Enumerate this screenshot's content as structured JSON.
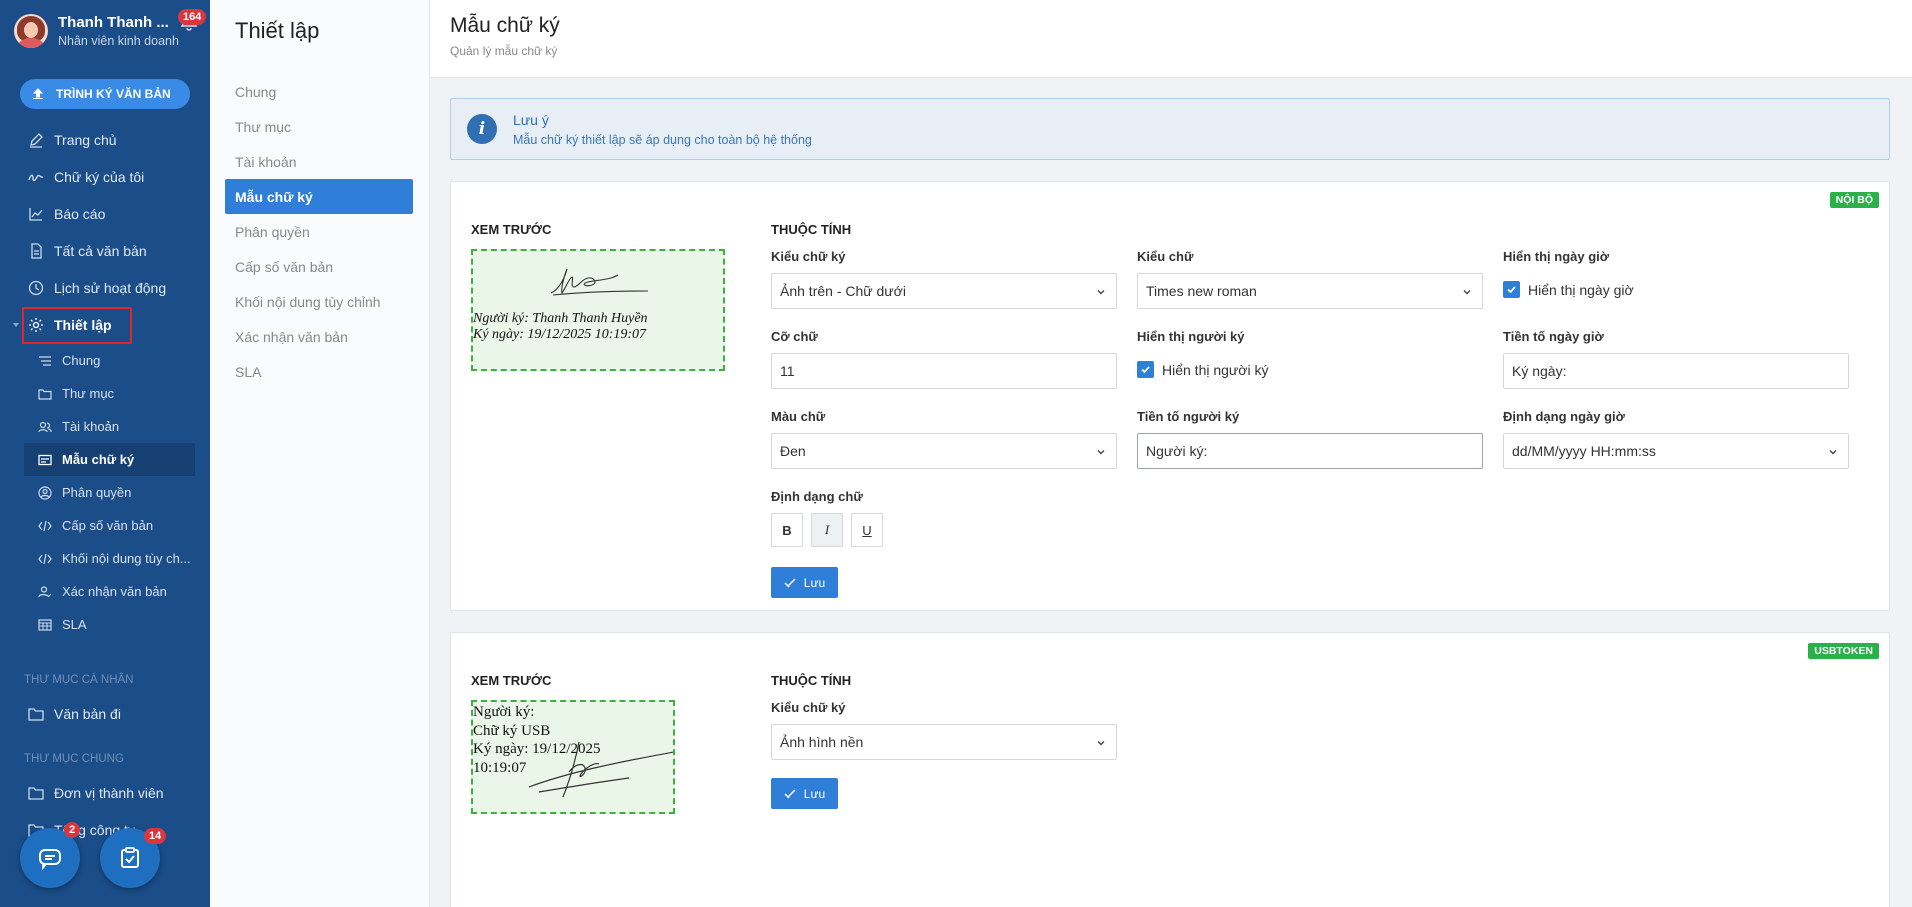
{
  "user": {
    "name": "Thanh Thanh Huyền",
    "name_short": "Thanh Thanh ...",
    "role": "Nhân viên kinh doanh",
    "notification_count": "164"
  },
  "sidebar": {
    "upload_label": "TRÌNH KÝ VĂN BẢN",
    "items": [
      {
        "label": "Trang chủ",
        "icon": "pen-icon"
      },
      {
        "label": "Chữ ký của tôi",
        "icon": "signature-icon"
      },
      {
        "label": "Báo cáo",
        "icon": "chart-icon"
      },
      {
        "label": "Tất cả văn bản",
        "icon": "document-icon"
      },
      {
        "label": "Lịch sử hoạt động",
        "icon": "clock-icon"
      },
      {
        "label": "Thiết lập",
        "icon": "gear-icon"
      }
    ],
    "sub_items": [
      {
        "label": "Chung",
        "icon": "lines-icon"
      },
      {
        "label": "Thư mục",
        "icon": "folder-icon"
      },
      {
        "label": "Tài khoản",
        "icon": "users-icon"
      },
      {
        "label": "Mẫu chữ ký",
        "icon": "card-icon"
      },
      {
        "label": "Phân quyền",
        "icon": "user-circle-icon"
      },
      {
        "label": "Cấp số văn bản",
        "icon": "code-icon"
      },
      {
        "label": "Khối nội dung tùy ch...",
        "icon": "code-icon"
      },
      {
        "label": "Xác nhận văn bản",
        "icon": "user-check-icon"
      },
      {
        "label": "SLA",
        "icon": "table-icon"
      }
    ],
    "section_personal": "THƯ MỤC CÁ NHÂN",
    "personal_items": [
      {
        "label": "Văn bản đi",
        "icon": "folder-icon"
      }
    ],
    "section_common": "THƯ MỤC CHUNG",
    "common_items": [
      {
        "label": "Đơn vị thành viên",
        "icon": "folder-icon"
      },
      {
        "label": "Tổng công ty",
        "icon": "folder-icon"
      }
    ],
    "chat_count": "2",
    "task_count": "14"
  },
  "subnav": {
    "title": "Thiết lập",
    "items": [
      "Chung",
      "Thư mục",
      "Tài khoản",
      "Mẫu chữ ký",
      "Phân quyền",
      "Cấp số văn bản",
      "Khối nội dung tùy chỉnh",
      "Xác nhận văn bản",
      "SLA"
    ]
  },
  "header": {
    "title": "Mẫu chữ ký",
    "subtitle": "Quản lý mẫu chữ ký"
  },
  "note": {
    "title": "Lưu ý",
    "text": "Mẫu chữ ký thiết lập sẽ áp dụng cho toàn bộ hệ thống"
  },
  "card1": {
    "tag": "NỘI BỘ",
    "preview_label": "XEM TRƯỚC",
    "props_label": "THUỘC TÍNH",
    "preview_line1": "Người ký: Thanh Thanh Huyền",
    "preview_line2": "Ký ngày: 19/12/2025 10:19:07",
    "sig_type_label": "Kiểu chữ ký",
    "sig_type_value": "Ảnh trên - Chữ dưới",
    "font_label": "Kiểu chữ",
    "font_value": "Times new roman",
    "show_date_label": "Hiển thị ngày giờ",
    "show_date_check": "Hiển thị ngày giờ",
    "size_label": "Cỡ chữ",
    "size_value": "11",
    "show_signer_label": "Hiển thị người ký",
    "show_signer_check": "Hiển thị người ký",
    "date_prefix_label": "Tiền tố ngày giờ",
    "date_prefix_value": "Ký ngày:",
    "color_label": "Màu chữ",
    "color_value": "Đen",
    "signer_prefix_label": "Tiền tố người ký",
    "signer_prefix_value": "Người ký:",
    "date_format_label": "Định dạng ngày giờ",
    "date_format_value": "dd/MM/yyyy HH:mm:ss",
    "text_format_label": "Định dạng chữ",
    "bold": "B",
    "italic": "I",
    "underline": "U",
    "save": "Lưu"
  },
  "card2": {
    "tag": "USBTOKEN",
    "preview_label": "XEM TRƯỚC",
    "props_label": "THUỘC TÍNH",
    "preview_lines": [
      "Người ký:",
      "Chữ ký USB",
      "Ký ngày: 19/12/2025",
      "10:19:07"
    ],
    "sig_type_label": "Kiểu chữ ký",
    "sig_type_value": "Ảnh hình nền",
    "save": "Lưu"
  },
  "colors": {
    "sidebar": "#1b4d89",
    "accent": "#2f7ed8",
    "tag_green": "#2ab14a",
    "badge_red": "#d9363e",
    "highlight_red": "#e0252d"
  }
}
